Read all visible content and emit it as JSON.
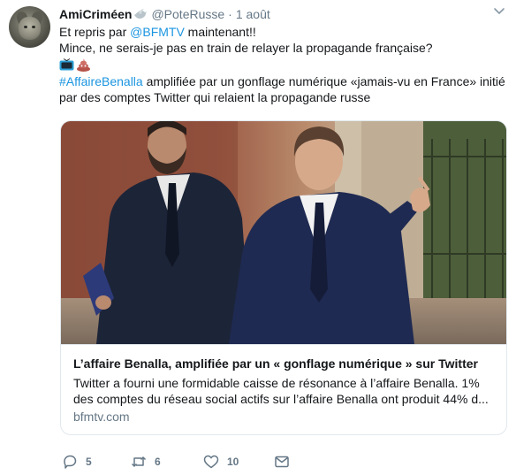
{
  "tweet": {
    "author_name": "AmiCriméen",
    "author_handle": "@PoteRusse",
    "separator": "·",
    "time": "1 août",
    "line1_prefix": "Et repris par ",
    "line1_mention": "@BFMTV",
    "line1_suffix": " maintenant!!",
    "line2": "Mince, ne serais-je pas en train de relayer la propagande française?",
    "emojis": [
      "tv-emoji",
      "pile-of-poo-emoji"
    ],
    "hashtag": "#AffaireBenalla",
    "line3_rest": " amplifiée par un gonflage numérique «jamais-vu en France» initié par des comptes Twitter qui relaient la propagande russe"
  },
  "card": {
    "title": "L’affaire Benalla, amplifiée par un « gonflage numérique » sur Twitter",
    "description": "Twitter a fourni une formidable caisse de résonance à l’affaire Benalla. 1% des comptes du réseau social actifs sur l’affaire Benalla ont produit 44% d...",
    "domain": "bfmtv.com"
  },
  "actions": {
    "reply_count": "5",
    "retweet_count": "6",
    "like_count": "10"
  },
  "colors": {
    "link": "#1b95e0",
    "secondary": "#657786",
    "border": "#e1e8ed"
  },
  "icons": [
    "avatar-cat",
    "dove-icon",
    "chevron-down-icon",
    "reply-icon",
    "retweet-icon",
    "like-icon",
    "direct-message-icon"
  ]
}
